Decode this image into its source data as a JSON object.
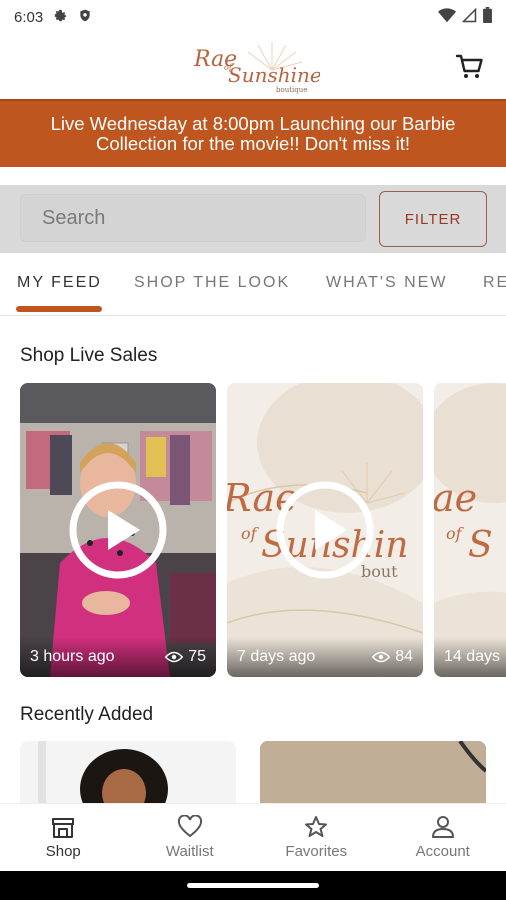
{
  "status_bar": {
    "time": "6:03"
  },
  "header": {
    "logo_text": "Rae of Sunshine boutique"
  },
  "banner": {
    "text": "Live Wednesday at 8:00pm Launching our Barbie Collection for the movie!! Don't miss it!"
  },
  "search": {
    "placeholder": "Search",
    "filter_label": "FILTER"
  },
  "tabs": [
    {
      "label": "MY FEED",
      "active": true
    },
    {
      "label": "SHOP THE LOOK",
      "active": false
    },
    {
      "label": "WHAT'S NEW",
      "active": false
    },
    {
      "label": "RE",
      "active": false
    }
  ],
  "sections": {
    "live_sales_title": "Shop Live Sales",
    "recent_title": "Recently Added"
  },
  "live_sales": [
    {
      "time_ago": "3 hours ago",
      "views": "75"
    },
    {
      "time_ago": "7 days ago",
      "views": "84"
    },
    {
      "time_ago": "14 days",
      "views": ""
    }
  ],
  "bottom_nav": [
    {
      "label": "Shop",
      "icon": "shop-icon",
      "active": true
    },
    {
      "label": "Waitlist",
      "icon": "heart-icon",
      "active": false
    },
    {
      "label": "Favorites",
      "icon": "star-icon",
      "active": false
    },
    {
      "label": "Account",
      "icon": "person-icon",
      "active": false
    }
  ],
  "colors": {
    "accent": "#c0561f",
    "filter_text": "#9a3a22"
  }
}
